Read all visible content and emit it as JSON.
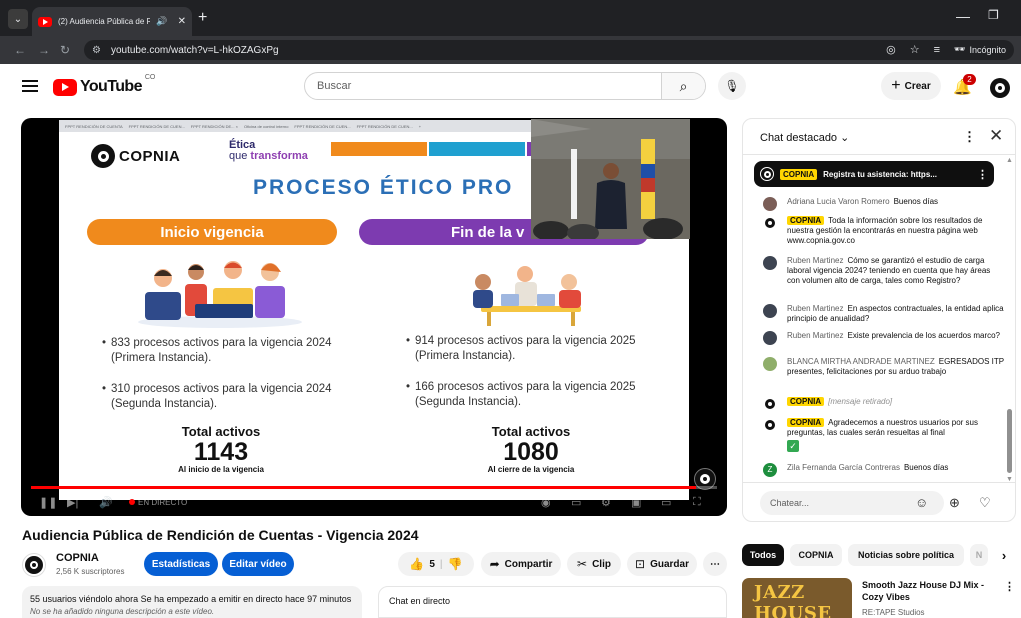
{
  "browser": {
    "tab_title": "(2) Audiencia Pública de Re",
    "url": "youtube.com/watch?v=L-hkOZAGxPg",
    "incognito_label": "Incógnito",
    "icons": [
      "chevron-down-icon",
      "close-icon",
      "plus-icon",
      "back-icon",
      "forward-icon",
      "reload-icon",
      "eye-off-icon",
      "star-icon",
      "tab-search-icon",
      "incognito-icon"
    ]
  },
  "header": {
    "logo_text": "YouTube",
    "logo_country": "CO",
    "search_placeholder": "Buscar",
    "create_label": "Crear",
    "notification_count": "2"
  },
  "slide": {
    "tabs": [
      "FPPT RENDICIÓN DE CUENTA",
      "FPPT RENDICIÓN DE CUEN...",
      "FPPT RENDICIÓN DE... ×",
      "Oficina de control interno",
      "FPPT RENDICIÓN DE CUEN...",
      "FPPT RENDICIÓN DE CUEN...",
      "+"
    ],
    "logo_text": "COPNIA",
    "tagline_1": "Ética",
    "tagline_2": "que",
    "tagline_3": "transforma",
    "title": "PROCESO ÉTICO PRO",
    "left_pill": "Inicio vigencia",
    "right_pill": "Fin de la v",
    "left_bullets": [
      "833 procesos activos para la vigencia 2024 (Primera Instancia).",
      "310 procesos activos para la vigencia 2024 (Segunda Instancia)."
    ],
    "right_bullets": [
      "914 procesos activos para la vigencia 2025 (Primera Instancia).",
      "166 procesos activos para la vigencia 2025 (Segunda Instancia)."
    ],
    "left_total_label": "Total activos",
    "left_total_value": "1143",
    "left_total_sub": "Al inicio de la vigencia",
    "right_total_label": "Total activos",
    "right_total_value": "1080",
    "right_total_sub": "Al cierre de la vigencia",
    "colors": {
      "orange": "#f08a1c",
      "purple": "#7d3bb0",
      "blue": "#2b6fb6",
      "teal": "#1fa0d0"
    }
  },
  "player": {
    "live_label": "EN DIRECTO",
    "progress": 0.97
  },
  "video": {
    "title": "Audiencia Pública de Rendición de Cuentas - Vigencia 2024",
    "channel_name": "COPNIA",
    "subscribers": "2,56 K suscriptores",
    "stats_button": "Estadísticas",
    "edit_button": "Editar vídeo",
    "likes": "5",
    "share_label": "Compartir",
    "clip_label": "Clip",
    "save_label": "Guardar",
    "description_line": "55 usuarios viéndolo ahora  Se ha empezado a emitir en directo hace 97 minutos",
    "description_empty": "No se ha añadido ninguna descripción a este vídeo.",
    "chat_replay_label": "Chat en directo"
  },
  "chat": {
    "title": "Chat destacado",
    "pinned_author": "COPNIA",
    "pinned_message": "Registra tu asistencia: https...",
    "messages": [
      {
        "author": "Adriana Lucia Varon Romero",
        "text": "Buenos días",
        "owner": false
      },
      {
        "author": "COPNIA",
        "text": "Toda la información sobre los resultados de nuestra gestión la encontrarás en nuestra página web www.copnia.gov.co",
        "owner": true
      },
      {
        "author": "Ruben Martinez",
        "text": "Cómo se garantizó el estudio de carga laboral vigencia 2024? teniendo en cuenta que hay áreas con volumen alto de carga, tales como Registro?",
        "owner": false
      },
      {
        "author": "Ruben Martinez",
        "text": "En aspectos contractuales, la entidad aplica principio de anualidad?",
        "owner": false
      },
      {
        "author": "Ruben Martinez",
        "text": "Existe prevalencia de los acuerdos marco?",
        "owner": false
      },
      {
        "author": "BLANCA MIRTHA ANDRADE MARTINEZ",
        "text": "EGRESADOS ITP presentes, felicitaciones por su arduo trabajo",
        "owner": false
      },
      {
        "author": "COPNIA",
        "text": "[mensaje retirado]",
        "owner": true
      },
      {
        "author": "COPNIA",
        "text": "Agradecemos a nuestros usuarios por sus preguntas, las cuales serán resueltas al final",
        "owner": true
      },
      {
        "author": "Zila Fernanda García Contreras",
        "text": "Buenos días",
        "owner": false
      }
    ],
    "input_placeholder": "Chatear...",
    "avatar_initial": "Z"
  },
  "recommendations": {
    "chips": [
      "Todos",
      "COPNIA",
      "Noticias sobre política",
      "N"
    ],
    "item_title": "Smooth Jazz House DJ Mix - Cozy Vibes",
    "item_channel": "RE:TAPE Studios",
    "thumb_text": "JAZZ HOUSE"
  }
}
